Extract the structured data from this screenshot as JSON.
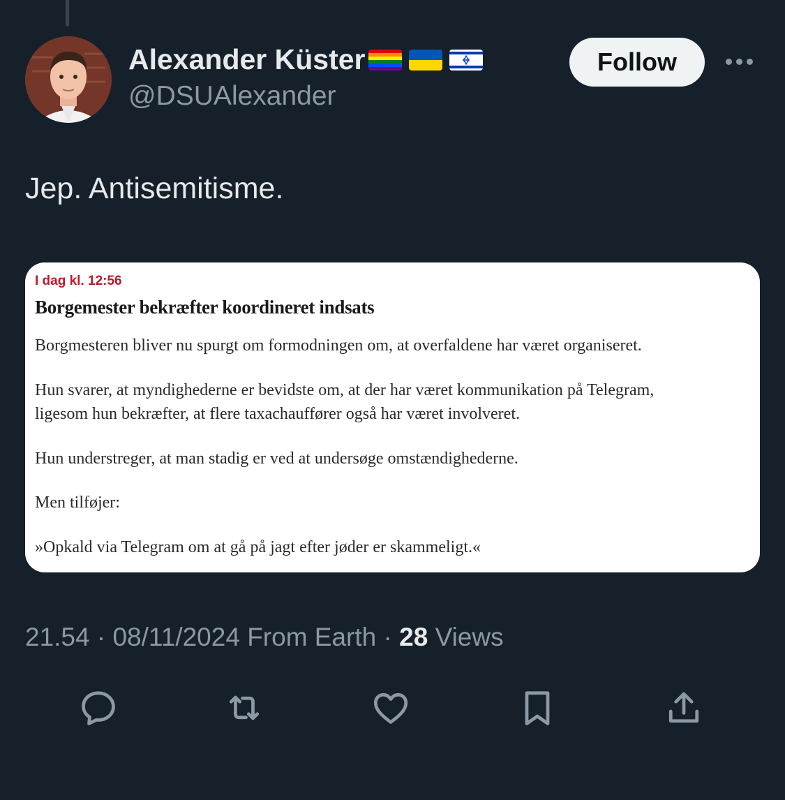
{
  "author": {
    "display_name": "Alexander Küster",
    "handle": "@DSUAlexander",
    "flags": [
      "rainbow-flag-icon",
      "ukraine-flag-icon",
      "israel-flag-icon"
    ]
  },
  "follow_label": "Follow",
  "tweet_text": "Jep. Antisemitisme.",
  "card": {
    "time": "I dag kl. 12:56",
    "title": "Borgemester bekræfter koordineret indsats",
    "p1": "Borgmesteren bliver nu spurgt om formodningen om, at overfaldene har været organiseret.",
    "p2a": "Hun svarer, at myndighederne er bevidste om, at der har været kommunikation på Telegram,",
    "p2b": "ligesom hun bekræfter, at flere taxachauffører også har været involveret.",
    "p3": "Hun understreger, at man stadig er ved at undersøge omstændighederne.",
    "p4": "Men tilføjer:",
    "p5": "»Opkald via Telegram om at gå på jagt efter jøder er skammeligt.«"
  },
  "meta": {
    "time": "21.54",
    "date": "08/11/2024",
    "source": "From Earth",
    "views_count": "28",
    "views_label": "Views"
  },
  "colors": {
    "background": "#16202b",
    "card_time": "#c0182a",
    "muted": "#8b98a5"
  },
  "actions": [
    "reply-icon",
    "retweet-icon",
    "like-icon",
    "bookmark-icon",
    "share-icon"
  ]
}
